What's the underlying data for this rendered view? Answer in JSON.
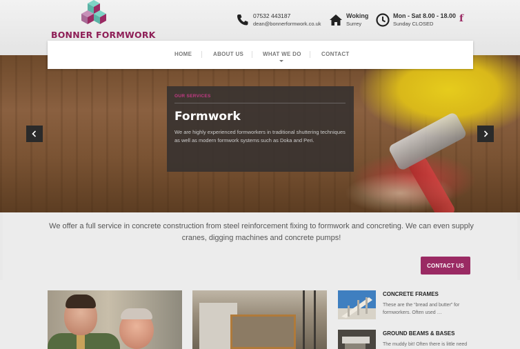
{
  "brand": {
    "name": "BONNER FORMWORK",
    "color": "#8e1f57"
  },
  "header": {
    "phone": "07532 443187",
    "email": "dean@bonnerformwork.co.uk",
    "location_title": "Woking",
    "location_sub": "Surrey",
    "hours_title": "Mon - Sat 8.00 - 18.00",
    "hours_sub": "Sunday CLOSED",
    "social_icon": "facebook-icon"
  },
  "nav": {
    "items": [
      {
        "label": "HOME"
      },
      {
        "label": "ABOUT US"
      },
      {
        "label": "WHAT WE DO"
      },
      {
        "label": "CONTACT"
      }
    ]
  },
  "slider": {
    "tag": "OUR SERVICES",
    "title": "Formwork",
    "text": "We are highly experienced formworkers in traditional shuttering techniques as well as modern formwork systems such as Doka and Peri.",
    "prev_icon": "chevron-left-icon",
    "next_icon": "chevron-right-icon"
  },
  "intro": {
    "text": "We offer a full service in concrete construction from steel reinforcement fixing to formwork and concreting. We can even supply cranes, digging machines and concrete pumps!",
    "button_label": "CONTACT US",
    "accent": "#9a2a63"
  },
  "services": [
    {
      "title": "CONCRETE FRAMES",
      "text": "These are the “bread and butter” for formworkers. Often used …"
    },
    {
      "title": "GROUND BEAMS & BASES",
      "text": "The muddy bit! Often there is little need"
    }
  ]
}
